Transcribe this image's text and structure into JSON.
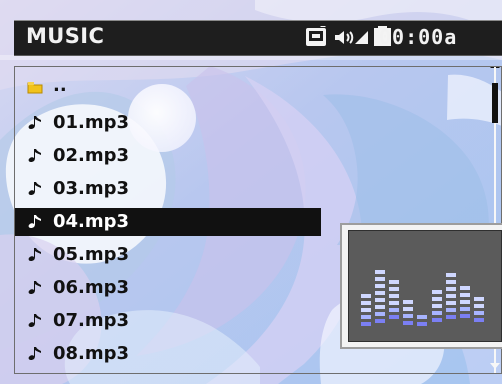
{
  "header": {
    "title": "MUSIC",
    "clock": "00:00a",
    "status_icons": [
      "media-card-icon",
      "volume-icon",
      "signal-icon",
      "battery-icon"
    ]
  },
  "file_list": {
    "items": [
      {
        "label": "..",
        "icon": "folder-icon",
        "selected": false
      },
      {
        "label": "01.mp3",
        "icon": "music-note-icon",
        "selected": false
      },
      {
        "label": "02.mp3",
        "icon": "music-note-icon",
        "selected": false
      },
      {
        "label": "03.mp3",
        "icon": "music-note-icon",
        "selected": false
      },
      {
        "label": "04.mp3",
        "icon": "music-note-icon",
        "selected": true
      },
      {
        "label": "05.mp3",
        "icon": "music-note-icon",
        "selected": false
      },
      {
        "label": "06.mp3",
        "icon": "music-note-icon",
        "selected": false
      },
      {
        "label": "07.mp3",
        "icon": "music-note-icon",
        "selected": false
      },
      {
        "label": "08.mp3",
        "icon": "music-note-icon",
        "selected": false
      }
    ]
  },
  "preview": {
    "icon": "equalizer-icon"
  },
  "colors": {
    "titlebar": "#1e1e1e",
    "selected_row": "#111111",
    "text": "#111111",
    "selected_text": "#ffffff",
    "preview_background": "#5b5b5b",
    "eq_light": "#cfd7ff",
    "eq_mid": "#a8b4ff",
    "eq_deep": "#7b7ff3"
  }
}
